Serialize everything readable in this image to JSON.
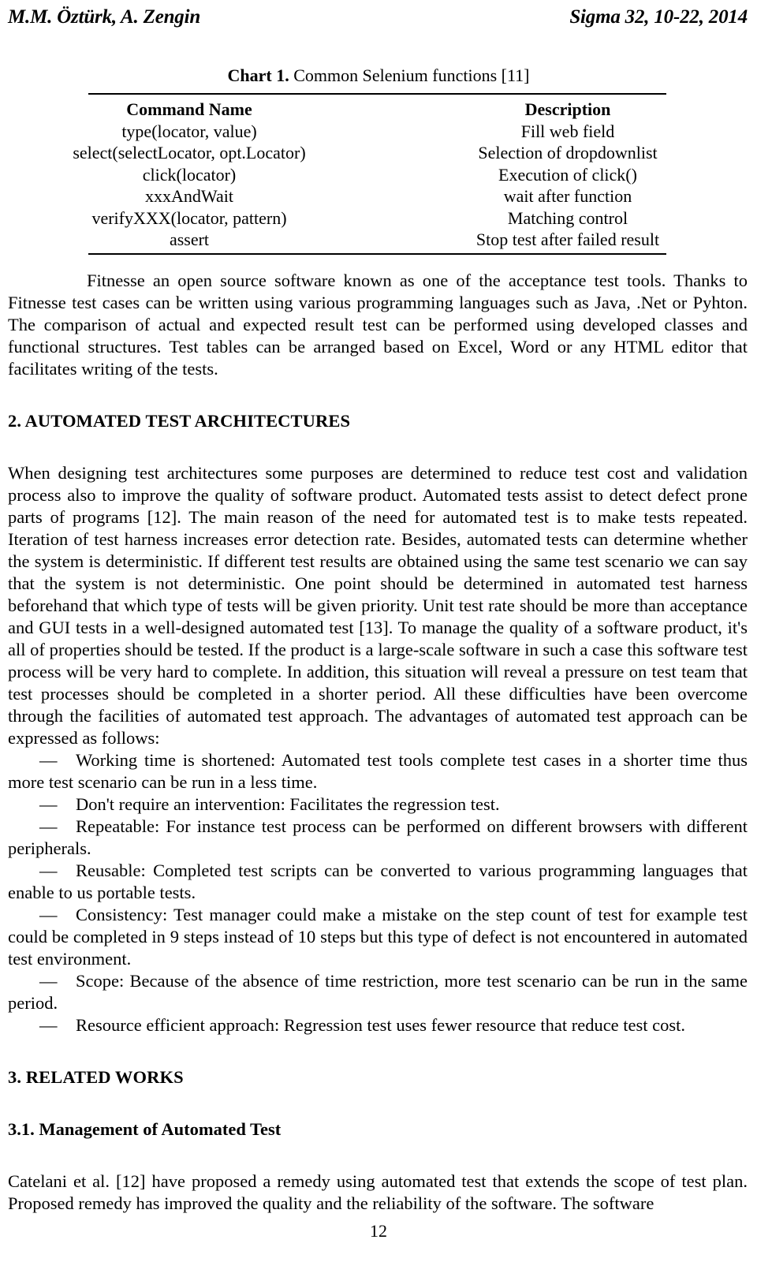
{
  "running_head": {
    "authors": "M.M. Öztürk, A. Zengin",
    "journal_ref": "Sigma 32, 10-22, 2014"
  },
  "table": {
    "caption_label": "Chart 1.",
    "caption_text": " Common Selenium functions [11]",
    "headers": [
      "Command Name",
      "Description"
    ],
    "rows": [
      [
        "type(locator, value)",
        "Fill web field"
      ],
      [
        "select(selectLocator, opt.Locator)",
        "Selection of dropdownlist"
      ],
      [
        "click(locator)",
        "Execution of click()"
      ],
      [
        "xxxAndWait",
        "wait after function"
      ],
      [
        "verifyXXX(locator, pattern)",
        "Matching control"
      ],
      [
        "assert",
        "Stop test after failed result"
      ]
    ]
  },
  "content": {
    "fitnesse_para": "Fitnesse an open source software known as one of the acceptance test tools. Thanks to Fitnesse test cases can be written using various programming languages such as Java, .Net or Pyhton. The comparison of actual and expected result test can be performed using developed classes and functional structures. Test tables can be arranged based on Excel, Word or any HTML editor that facilitates writing of the tests.",
    "section2_heading": "2. AUTOMATED TEST ARCHITECTURES",
    "section2_para": "When designing test architectures some purposes are determined to reduce test cost and validation process also to improve the quality of software product. Automated tests assist to detect defect prone parts of programs [12]. The main reason of the need for automated test is to make tests repeated. Iteration of test harness increases error detection rate. Besides, automated tests can determine whether the system is deterministic. If different test results are obtained using the same test scenario we can say that the system is not deterministic. One point should be determined in automated test harness beforehand that which type of tests will be given priority. Unit test rate should be more than acceptance and GUI tests in a well-designed automated test [13]. To manage the quality of a software product, it's all of properties should be tested. If the product is a large-scale software in such a case this software test process will be very hard to complete. In addition, this situation will reveal a pressure on test team that test processes should be completed in a shorter period. All these difficulties have been overcome through the facilities of automated test approach. The advantages of automated test approach can be expressed as follows:",
    "advantages": [
      "Working time is shortened: Automated test tools complete test cases in a shorter time thus more test scenario can be run in a less time.",
      "Don't require an intervention: Facilitates the regression test.",
      "Repeatable: For instance test process can be performed on different browsers with different peripherals.",
      "Reusable: Completed test scripts can be converted to various programming languages that enable to us portable tests.",
      "Consistency: Test manager could make a mistake on the step count of test for example test could be completed in 9 steps instead of 10 steps but this type of defect is not encountered in automated test environment.",
      "Scope: Because of the absence of time restriction, more test scenario can be run in the same period.",
      "Resource efficient approach: Regression test uses fewer resource that reduce test cost."
    ],
    "dash_marker": "—",
    "section3_heading": "3. RELATED WORKS",
    "section31_heading": "3.1. Management of Automated Test",
    "section31_para": "Catelani et al. [12] have proposed a remedy using automated test that extends the scope of test plan. Proposed remedy has improved the quality and the reliability of the software. The software"
  },
  "footer": {
    "page_number": "12"
  }
}
